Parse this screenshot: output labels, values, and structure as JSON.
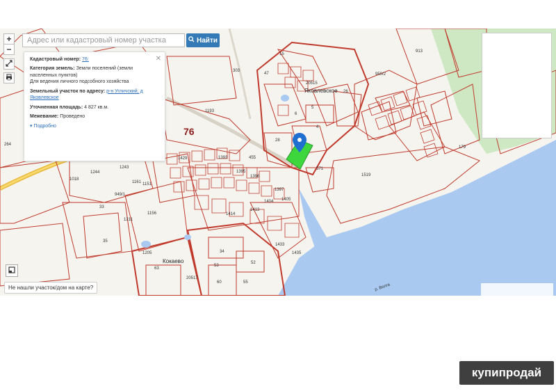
{
  "search": {
    "placeholder": "Адрес или кадастровый номер участка",
    "button_label": "Найти"
  },
  "zoom": {
    "in_label": "+",
    "out_label": "−"
  },
  "info": {
    "cadastral_label": "Кадастровый номер:",
    "cadastral_value": "76:",
    "category_label": "Категория земель:",
    "category_value": "Земли поселений (земли населенных пунктов)",
    "usage_value": "Для ведения личного подсобного хозяйства",
    "address_label": "Земельный участок по адресу:",
    "address_value": "р-н Угличский, д Яковлевское",
    "area_label": "Уточненная площадь:",
    "area_value": "4 827 кв.м.",
    "survey_label": "Межевание:",
    "survey_value": "Проведено",
    "more_label": "Подробно"
  },
  "not_found_label": "Не нашли участок/дом на карте?",
  "watermark": "купипродай",
  "map": {
    "place_names": [
      "Яковлевское",
      "Кокаево"
    ],
    "quarter_numbers": [
      "76",
      "20515",
      "20517"
    ],
    "road_label": "р. Волга",
    "parcel_numbers": [
      "1193",
      "303",
      "1156",
      "1244",
      "1243",
      "264",
      "1018",
      "33",
      "35",
      "1205",
      "1519",
      "571",
      "455",
      "28",
      "4",
      "5",
      "6",
      "26",
      "15",
      "47",
      "913",
      "179",
      "1429",
      "1395",
      "1393",
      "1396",
      "1397",
      "1405",
      "1413",
      "1404",
      "1414",
      "1433",
      "1435",
      "63",
      "60",
      "55",
      "34",
      "52",
      "53",
      "949/1",
      "950/2",
      "1151",
      "1161",
      "1211"
    ]
  },
  "colors": {
    "water": "#a8c8ef",
    "parcel_line": "#c0392b",
    "selected_parcel": "#3dd63d",
    "forest": "#cbe6bf",
    "search_button": "#337ab7"
  }
}
